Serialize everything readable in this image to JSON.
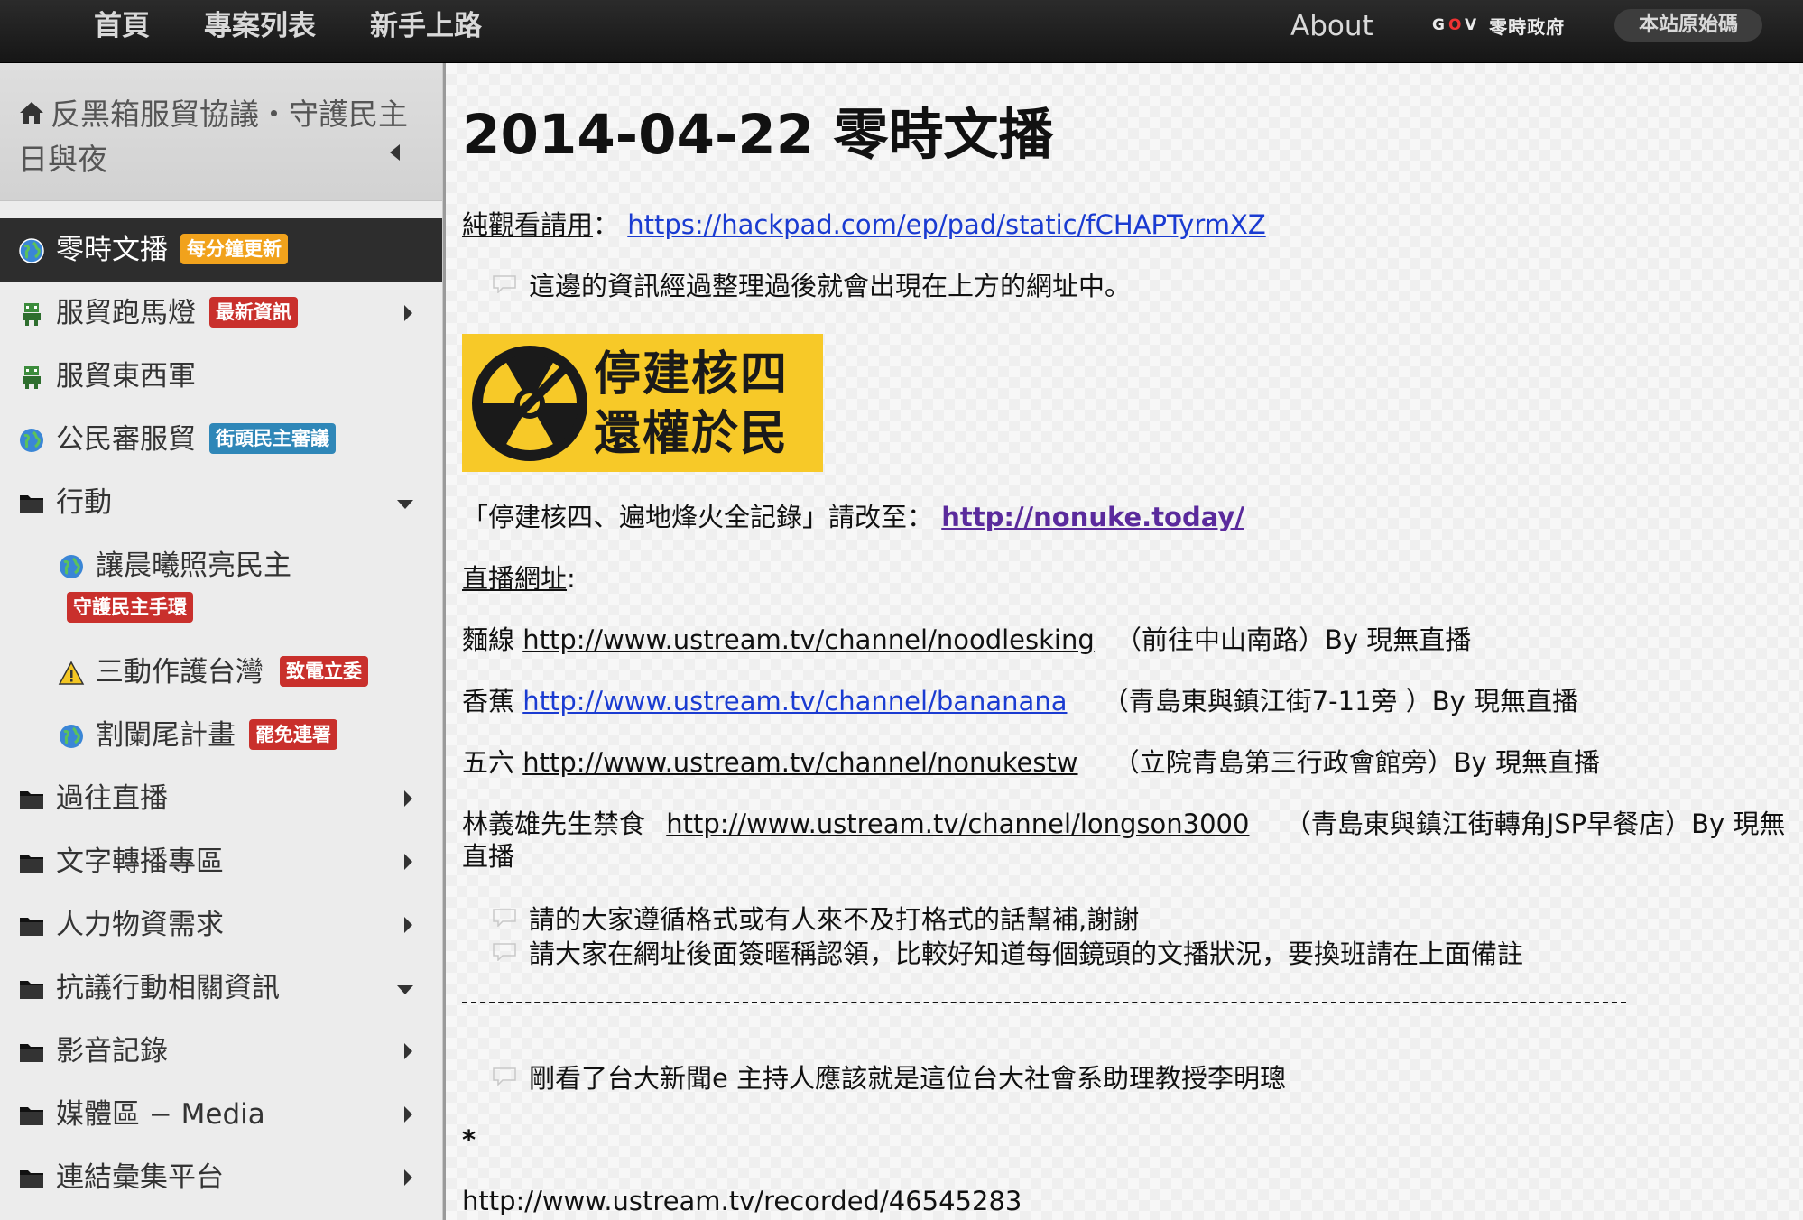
{
  "topbar": {
    "nav": [
      "首頁",
      "專案列表",
      "新手上路"
    ],
    "about": "About",
    "gov_mark_left": "G",
    "gov_mark_o": "O",
    "gov_mark_right": "V",
    "gov_name": "零時政府",
    "source_button": "本站原始碼"
  },
  "sidebar": {
    "title": "反黑箱服貿協議・守護民主日與夜",
    "items": [
      {
        "label": "零時文播",
        "badge": "每分鐘更新"
      },
      {
        "label": "服貿跑馬燈",
        "badge": "最新資訊"
      },
      {
        "label": "服貿東西軍"
      },
      {
        "label": "公民審服貿",
        "badge": "街頭民主審議"
      },
      {
        "label": "行動"
      },
      {
        "label": "讓晨曦照亮民主",
        "badge": "守護民主手環"
      },
      {
        "label": "三動作護台灣",
        "badge": "致電立委"
      },
      {
        "label": "割闌尾計畫",
        "badge": "罷免連署"
      },
      {
        "label": "過往直播"
      },
      {
        "label": "文字轉播專區"
      },
      {
        "label": "人力物資需求"
      },
      {
        "label": "抗議行動相關資訊"
      },
      {
        "label": "影音記錄"
      },
      {
        "label": "媒體區 − Media"
      },
      {
        "label": "連結彙集平台"
      }
    ]
  },
  "main": {
    "title": "2014-04-22 零時文播",
    "view_label": "純觀看請用",
    "view_sep": "：",
    "view_url": "https://hackpad.com/ep/pad/static/fCHAPTyrmXZ",
    "note1": "這邊的資訊經過整理過後就會出現在上方的網址中。",
    "banner_text": "停建核四還權於民",
    "nonuke_text": "「停建核四、遍地烽火全記錄」請改至：",
    "nonuke_url": "http://nonuke.today/",
    "live_label": "直播網址",
    "live_colon": ":",
    "streams": [
      {
        "name": "麵線",
        "url": "http://www.ustream.tv/channel/noodlesking",
        "note": "（前往中山南路）By 現無直播"
      },
      {
        "name": "香蕉",
        "url": "http://www.ustream.tv/channel/bananana",
        "note": "（青島東與鎮江街7-11旁 ）By 現無直播"
      },
      {
        "name": "五六",
        "url": "http://www.ustream.tv/channel/nonukestw",
        "note": "（立院青島第三行政會館旁）By 現無直播"
      },
      {
        "name": "林義雄先生禁食",
        "url": "http://www.ustream.tv/channel/longson3000",
        "note": "（青島東與鎮江街轉角JSP早餐店）By 現無",
        "cont": "直播"
      }
    ],
    "note2": "請的大家遵循格式或有人來不及打格式的話幫補,謝謝",
    "note3": "請大家在網址後面簽暱稱認領，比較好知道每個鏡頭的文播狀況，要換班請在上面備註",
    "note4": "剛看了台大新聞e 主持人應該就是這位台大社會系助理教授李明璁",
    "star": "*",
    "recorded_url": "http://www.ustream.tv/recorded/46545283"
  }
}
